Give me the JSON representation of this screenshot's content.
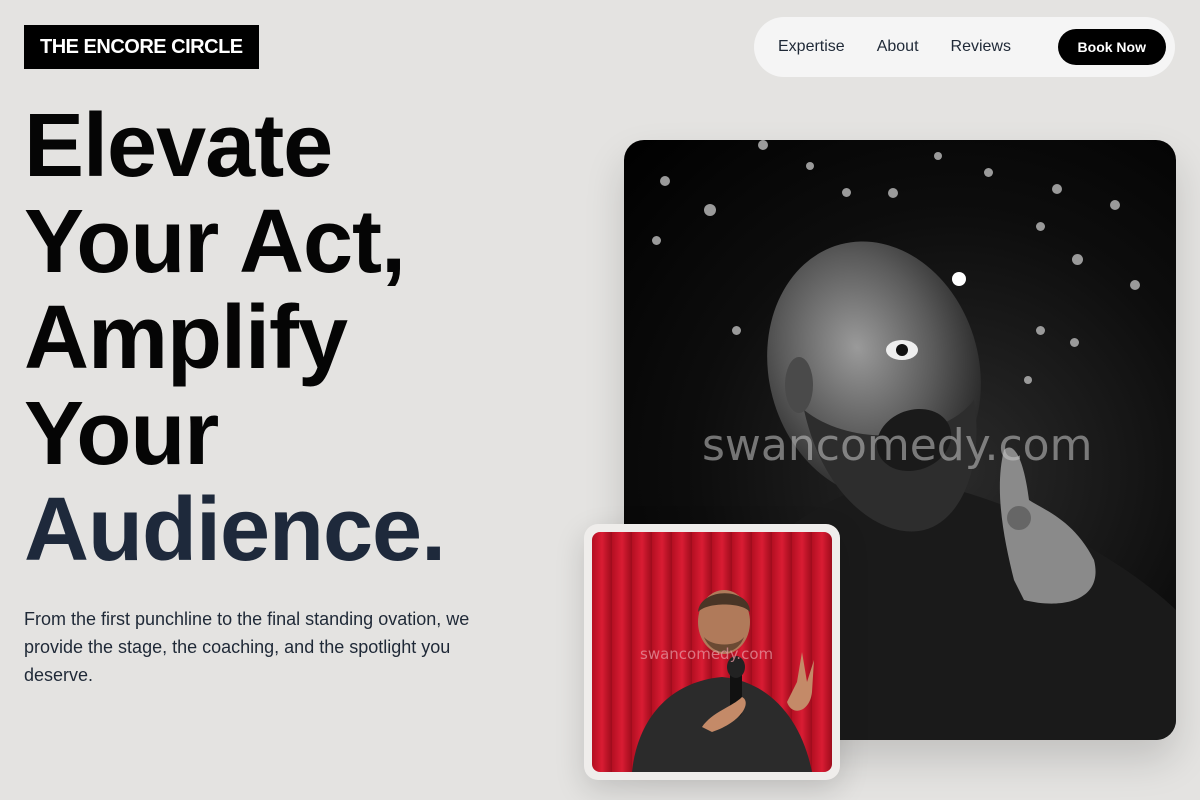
{
  "brand": {
    "name": "THE ENCORE CIRCLE"
  },
  "nav": {
    "items": [
      {
        "label": "Expertise"
      },
      {
        "label": "About"
      },
      {
        "label": "Reviews"
      }
    ],
    "cta_label": "Book Now"
  },
  "hero": {
    "headline_lines": [
      "Elevate",
      "Your Act,",
      "Amplify",
      "Your",
      "Audience."
    ],
    "subtext": "From the first punchline to the final standing ovation, we provide the stage, the coaching, and the spotlight you deserve."
  },
  "images": {
    "main_photo": {
      "subject": "bald bearded comedian pointing at camera",
      "watermark": "swancomedy.com"
    },
    "inset_photo": {
      "subject": "comedian with microphone in front of red curtain",
      "watermark": "swancomedy.com"
    }
  },
  "colors": {
    "accent": "#1e293b",
    "background": "#e4e3e1",
    "button": "#000000"
  }
}
